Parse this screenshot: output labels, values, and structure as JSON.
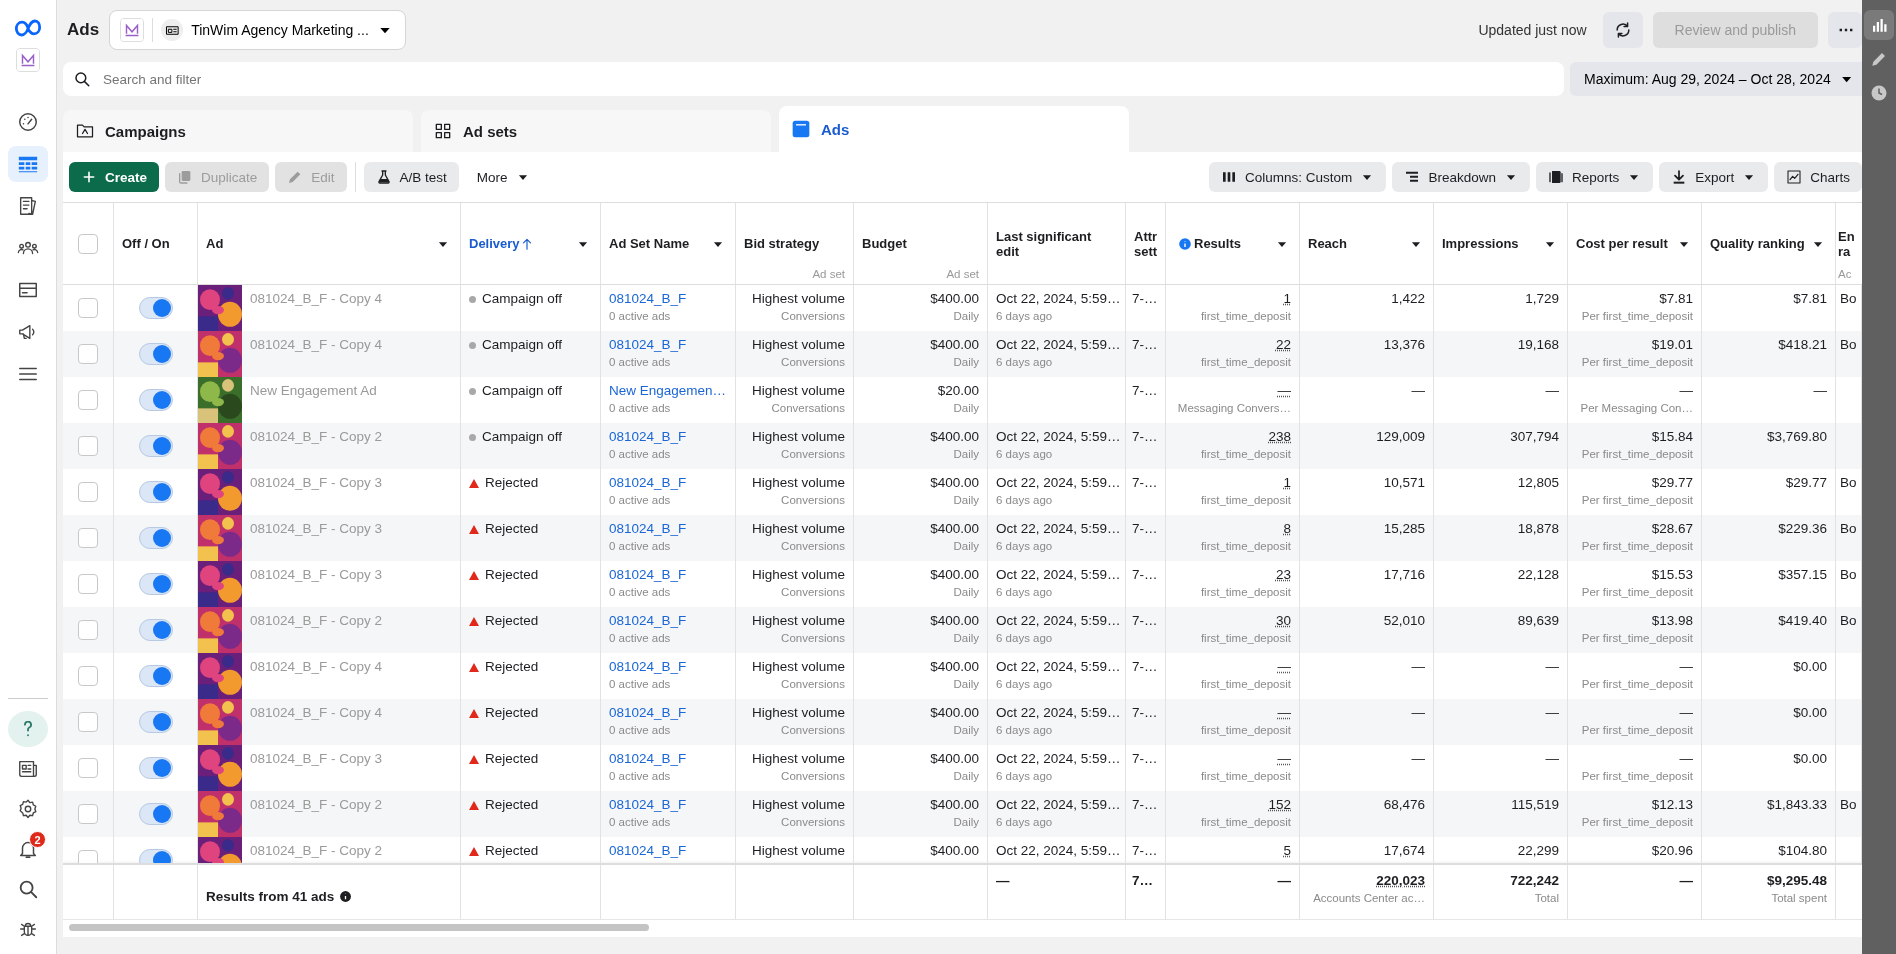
{
  "sidebar": {
    "items": [
      {
        "selected": false
      },
      {
        "selected": true
      },
      {
        "selected": false
      },
      {
        "selected": false
      },
      {
        "selected": false
      },
      {
        "selected": false
      },
      {
        "selected": false
      }
    ],
    "bottom_items": [
      {
        "selected": false
      },
      {
        "selected": false
      },
      {
        "selected": false
      },
      {
        "selected": false,
        "badge": "2"
      },
      {
        "selected": false
      },
      {
        "selected": false
      }
    ]
  },
  "header": {
    "title": "Ads",
    "account": "TinWim Agency Marketing ...",
    "updated": "Updated just now",
    "publish_button": {
      "label": "Review and publish",
      "disabled": true
    }
  },
  "search": {
    "placeholder": "Search and filter"
  },
  "date_range": "Maximum: Aug 29, 2024 – Oct 28, 2024",
  "tabs": [
    {
      "label": "Campaigns",
      "selected": false
    },
    {
      "label": "Ad sets",
      "selected": false
    },
    {
      "label": "Ads",
      "selected": true
    }
  ],
  "toolbar": {
    "left": [
      {
        "label": "Create",
        "kind": "primary",
        "disabled": false,
        "caret": false
      },
      {
        "label": "Duplicate",
        "kind": "secondary",
        "disabled": true,
        "caret": false
      },
      {
        "label": "Edit",
        "kind": "secondary",
        "disabled": true,
        "caret": false
      },
      {
        "label": "A/B test",
        "kind": "secondary",
        "disabled": false,
        "caret": false
      },
      {
        "label": "More",
        "kind": "plain",
        "disabled": false,
        "caret": true
      }
    ],
    "right": [
      {
        "label": "Columns: Custom",
        "kind": "secondary",
        "disabled": false,
        "caret": true
      },
      {
        "label": "Breakdown",
        "kind": "secondary",
        "disabled": false,
        "caret": true
      },
      {
        "label": "Reports",
        "kind": "secondary",
        "disabled": false,
        "caret": true
      },
      {
        "label": "Export",
        "kind": "secondary",
        "disabled": false,
        "caret": true
      },
      {
        "label": "Charts",
        "kind": "secondary",
        "disabled": false,
        "caret": false
      }
    ]
  },
  "table": {
    "select_all": {
      "checked": false
    },
    "columns": [
      {
        "label": "Off / On",
        "sorted": false,
        "menu": false
      },
      {
        "label": "Ad",
        "sorted": false,
        "menu": true
      },
      {
        "label": "Delivery",
        "sorted": true,
        "menu": true
      },
      {
        "label": "Ad Set Name",
        "sorted": false,
        "menu": true
      },
      {
        "label": "Bid strategy",
        "sublabel": "Ad set",
        "sorted": false,
        "menu": false
      },
      {
        "label": "Budget",
        "sublabel": "Ad set",
        "sorted": false,
        "menu": false
      },
      {
        "label": "Last significant edit",
        "sorted": false,
        "menu": false
      },
      {
        "label": "Attr sett",
        "sorted": false
      },
      {
        "label": "Results",
        "info": true,
        "sorted": false,
        "menu": true
      },
      {
        "label": "Reach",
        "sorted": false,
        "menu": true
      },
      {
        "label": "Impressions",
        "sorted": false,
        "menu": true
      },
      {
        "label": "Cost per result",
        "sorted": false,
        "menu": true
      },
      {
        "label": "Quality ranking",
        "sorted": false,
        "menu": true
      },
      {
        "label": "En ra",
        "sublabel": "Ac",
        "sorted": false
      }
    ],
    "rows": [
      {
        "checked": false,
        "on": true,
        "ad_name": "081024_B_F - Copy 4",
        "delivery": "Campaign off",
        "kind": "off",
        "ad_set": "081024_B_F",
        "ad_set_note": "0 active ads",
        "bid_strategy": "Highest volume",
        "bid_note": "Conversions",
        "budget": "$400.00",
        "budget_note": "Daily",
        "last_edit": "Oct 22, 2024, 5:59…",
        "last_edit_note": "6 days ago",
        "attr": "7-…",
        "results": "1",
        "results_note": "first_time_deposit",
        "reach": "1,422",
        "impressions": "1,729",
        "cost": "$7.81",
        "cost_note": "Per first_time_deposit",
        "quality": "$7.81",
        "column_15": "Bo"
      },
      {
        "checked": false,
        "on": true,
        "ad_name": "081024_B_F - Copy 4",
        "delivery": "Campaign off",
        "kind": "off",
        "ad_set": "081024_B_F",
        "ad_set_note": "0 active ads",
        "bid_strategy": "Highest volume",
        "bid_note": "Conversions",
        "budget": "$400.00",
        "budget_note": "Daily",
        "last_edit": "Oct 22, 2024, 5:59…",
        "last_edit_note": "6 days ago",
        "attr": "7-…",
        "results": "22",
        "results_note": "first_time_deposit",
        "reach": "13,376",
        "impressions": "19,168",
        "cost": "$19.01",
        "cost_note": "Per first_time_deposit",
        "quality": "$418.21",
        "column_15": "Bo"
      },
      {
        "checked": false,
        "on": true,
        "ad_name": "New Engagement Ad",
        "delivery": "Campaign off",
        "kind": "off",
        "ad_set": "New Engagemen…",
        "ad_set_note": "0 active ads",
        "bid_strategy": "Highest volume",
        "bid_note": "Conversations",
        "budget": "$20.00",
        "budget_note": "Daily",
        "attr": "7-…",
        "results": "—",
        "results_note": "Messaging Convers…",
        "reach": "—",
        "impressions": "—",
        "cost": "—",
        "cost_note": "Per Messaging Con…",
        "quality": "—"
      },
      {
        "checked": false,
        "on": true,
        "ad_name": "081024_B_F - Copy 2",
        "delivery": "Campaign off",
        "kind": "off",
        "ad_set": "081024_B_F",
        "ad_set_note": "0 active ads",
        "bid_strategy": "Highest volume",
        "bid_note": "Conversions",
        "budget": "$400.00",
        "budget_note": "Daily",
        "last_edit": "Oct 22, 2024, 5:59…",
        "last_edit_note": "6 days ago",
        "attr": "7-…",
        "results": "238",
        "results_note": "first_time_deposit",
        "reach": "129,009",
        "impressions": "307,794",
        "cost": "$15.84",
        "cost_note": "Per first_time_deposit",
        "quality": "$3,769.80"
      },
      {
        "checked": false,
        "on": true,
        "ad_name": "081024_B_F - Copy 3",
        "delivery": "Rejected",
        "kind": "rejected",
        "ad_set": "081024_B_F",
        "ad_set_note": "0 active ads",
        "bid_strategy": "Highest volume",
        "bid_note": "Conversions",
        "budget": "$400.00",
        "budget_note": "Daily",
        "last_edit": "Oct 22, 2024, 5:59…",
        "last_edit_note": "6 days ago",
        "attr": "7-…",
        "results": "1",
        "results_note": "first_time_deposit",
        "reach": "10,571",
        "impressions": "12,805",
        "cost": "$29.77",
        "cost_note": "Per first_time_deposit",
        "quality": "$29.77",
        "column_15": "Bo"
      },
      {
        "checked": false,
        "on": true,
        "ad_name": "081024_B_F - Copy 3",
        "delivery": "Rejected",
        "kind": "rejected",
        "ad_set": "081024_B_F",
        "ad_set_note": "0 active ads",
        "bid_strategy": "Highest volume",
        "bid_note": "Conversions",
        "budget": "$400.00",
        "budget_note": "Daily",
        "last_edit": "Oct 22, 2024, 5:59…",
        "last_edit_note": "6 days ago",
        "attr": "7-…",
        "results": "8",
        "results_note": "first_time_deposit",
        "reach": "15,285",
        "impressions": "18,878",
        "cost": "$28.67",
        "cost_note": "Per first_time_deposit",
        "quality": "$229.36",
        "column_15": "Bo"
      },
      {
        "checked": false,
        "on": true,
        "ad_name": "081024_B_F - Copy 3",
        "delivery": "Rejected",
        "kind": "rejected",
        "ad_set": "081024_B_F",
        "ad_set_note": "0 active ads",
        "bid_strategy": "Highest volume",
        "bid_note": "Conversions",
        "budget": "$400.00",
        "budget_note": "Daily",
        "last_edit": "Oct 22, 2024, 5:59…",
        "last_edit_note": "6 days ago",
        "attr": "7-…",
        "results": "23",
        "results_note": "first_time_deposit",
        "reach": "17,716",
        "impressions": "22,128",
        "cost": "$15.53",
        "cost_note": "Per first_time_deposit",
        "quality": "$357.15",
        "column_15": "Bo"
      },
      {
        "checked": false,
        "on": true,
        "ad_name": "081024_B_F - Copy 2",
        "delivery": "Rejected",
        "kind": "rejected",
        "ad_set": "081024_B_F",
        "ad_set_note": "0 active ads",
        "bid_strategy": "Highest volume",
        "bid_note": "Conversions",
        "budget": "$400.00",
        "budget_note": "Daily",
        "last_edit": "Oct 22, 2024, 5:59…",
        "last_edit_note": "6 days ago",
        "attr": "7-…",
        "results": "30",
        "results_note": "first_time_deposit",
        "reach": "52,010",
        "impressions": "89,639",
        "cost": "$13.98",
        "cost_note": "Per first_time_deposit",
        "quality": "$419.40",
        "column_15": "Bo"
      },
      {
        "checked": false,
        "on": true,
        "ad_name": "081024_B_F - Copy 4",
        "delivery": "Rejected",
        "kind": "rejected",
        "ad_set": "081024_B_F",
        "ad_set_note": "0 active ads",
        "bid_strategy": "Highest volume",
        "bid_note": "Conversions",
        "budget": "$400.00",
        "budget_note": "Daily",
        "last_edit": "Oct 22, 2024, 5:59…",
        "last_edit_note": "6 days ago",
        "attr": "7-…",
        "results": "—",
        "results_note": "first_time_deposit",
        "reach": "—",
        "impressions": "—",
        "cost": "—",
        "cost_note": "Per first_time_deposit",
        "quality": "$0.00"
      },
      {
        "checked": false,
        "on": true,
        "ad_name": "081024_B_F - Copy 4",
        "delivery": "Rejected",
        "kind": "rejected",
        "ad_set": "081024_B_F",
        "ad_set_note": "0 active ads",
        "bid_strategy": "Highest volume",
        "bid_note": "Conversions",
        "budget": "$400.00",
        "budget_note": "Daily",
        "last_edit": "Oct 22, 2024, 5:59…",
        "last_edit_note": "6 days ago",
        "attr": "7-…",
        "results": "—",
        "results_note": "first_time_deposit",
        "reach": "—",
        "impressions": "—",
        "cost": "—",
        "cost_note": "Per first_time_deposit",
        "quality": "$0.00"
      },
      {
        "checked": false,
        "on": true,
        "ad_name": "081024_B_F - Copy 3",
        "delivery": "Rejected",
        "kind": "rejected",
        "ad_set": "081024_B_F",
        "ad_set_note": "0 active ads",
        "bid_strategy": "Highest volume",
        "bid_note": "Conversions",
        "budget": "$400.00",
        "budget_note": "Daily",
        "last_edit": "Oct 22, 2024, 5:59…",
        "last_edit_note": "6 days ago",
        "attr": "7-…",
        "results": "—",
        "results_note": "first_time_deposit",
        "reach": "—",
        "impressions": "—",
        "cost": "—",
        "cost_note": "Per first_time_deposit",
        "quality": "$0.00"
      },
      {
        "checked": false,
        "on": true,
        "ad_name": "081024_B_F - Copy 2",
        "delivery": "Rejected",
        "kind": "rejected",
        "ad_set": "081024_B_F",
        "ad_set_note": "0 active ads",
        "bid_strategy": "Highest volume",
        "bid_note": "Conversions",
        "budget": "$400.00",
        "budget_note": "Daily",
        "last_edit": "Oct 22, 2024, 5:59…",
        "last_edit_note": "6 days ago",
        "attr": "7-…",
        "results": "152",
        "results_note": "first_time_deposit",
        "reach": "68,476",
        "impressions": "115,519",
        "cost": "$12.13",
        "cost_note": "Per first_time_deposit",
        "quality": "$1,843.33",
        "column_15": "Bo"
      },
      {
        "checked": false,
        "on": true,
        "ad_name": "081024_B_F - Copy 2",
        "delivery": "Rejected",
        "kind": "rejected",
        "ad_set": "081024_B_F",
        "bid_strategy": "Highest volume",
        "budget": "$400.00",
        "last_edit": "Oct 22, 2024, 5:59…",
        "attr": "7-…",
        "results": "5",
        "reach": "17,674",
        "impressions": "22,299",
        "cost": "$20.96",
        "quality": "$104.80"
      }
    ],
    "footer": {
      "label": "Results from 41 ads",
      "last_edit": "—",
      "attr": "7…",
      "results": "—",
      "reach": "220,023",
      "reach_note": "Accounts Center ac…",
      "impressions": "722,242",
      "impressions_note": "Total",
      "cost": "—",
      "quality": "$9,295.48",
      "quality_note": "Total spent"
    }
  },
  "right_rail": [
    {
      "selected": true
    },
    {
      "selected": false
    },
    {
      "selected": false
    }
  ]
}
